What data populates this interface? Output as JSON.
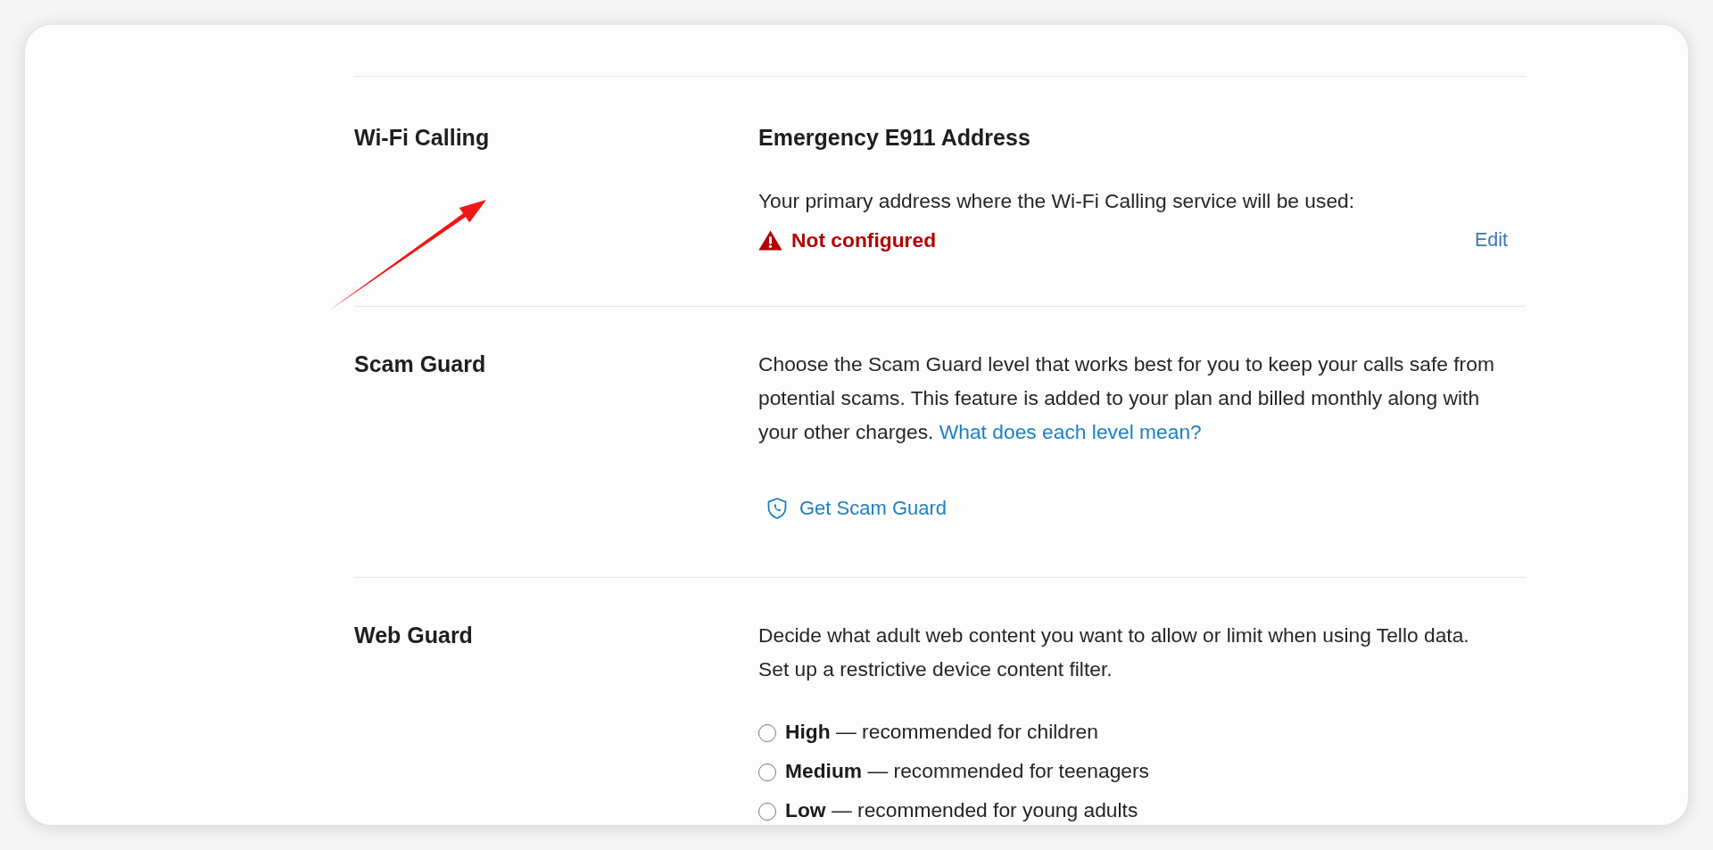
{
  "sections": [
    {
      "kind": "address",
      "title": "Wi-Fi Calling",
      "heading": "Emergency E911 Address",
      "description": "Your primary address where the Wi-Fi Calling service will be used:",
      "status": {
        "kind": "warning",
        "text": "Not configured"
      },
      "action": "Edit"
    },
    {
      "kind": "info",
      "title": "Scam Guard",
      "description": "Choose the Scam Guard level that works best for you to keep your calls safe from potential scams. This feature is added to your plan and billed monthly along with your other charges.",
      "link": "What does each level mean?",
      "button": "Get Scam Guard"
    },
    {
      "kind": "options",
      "title": "Web Guard",
      "description": [
        "Decide what adult web content you want to allow or limit when using Tello data.",
        "Set up a restrictive device content filter."
      ],
      "options": [
        {
          "label": "**High** — recommended for children",
          "selected": false
        },
        {
          "label": "**Medium** — recommended for teenagers",
          "selected": false
        },
        {
          "label": "**Low** — recommended for young adults",
          "selected": false
        }
      ]
    }
  ]
}
